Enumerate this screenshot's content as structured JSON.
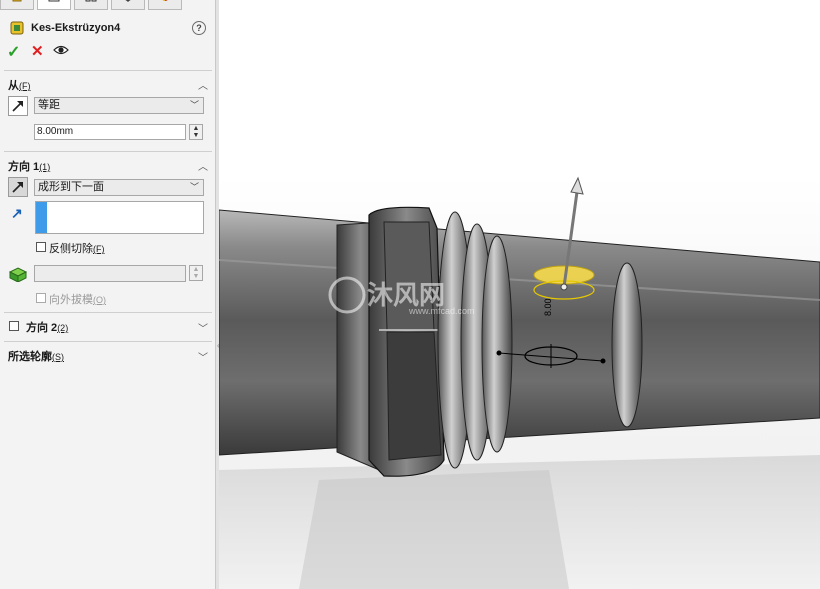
{
  "feature": {
    "name": "Kes-Ekstrüzyon4",
    "help": "?"
  },
  "actions": {
    "ok": "✓",
    "cancel": "✕"
  },
  "from": {
    "heading": "从",
    "mnemonic": "(F)",
    "type_value": "等距",
    "offset_value": "8.00mm"
  },
  "direction1": {
    "heading": "方向 1",
    "mnemonic": "(1)",
    "end_condition": "成形到下一面",
    "flip_label": "反侧切除",
    "flip_mnemonic": "(F)",
    "draft_label": "向外拔模",
    "draft_mnemonic": "(O)",
    "draft_value": ""
  },
  "direction2": {
    "heading": "方向 2",
    "mnemonic": "(2)"
  },
  "contours": {
    "heading": "所选轮廓",
    "mnemonic": "(S)"
  },
  "watermark": {
    "brand": "沐风网",
    "url": "www.mfcad.com"
  },
  "dimension_text": "8.00",
  "colors": {
    "accent": "#3d9be9",
    "ok": "#2aa02a",
    "cancel": "#e02020",
    "highlight": "#ffe14a"
  }
}
